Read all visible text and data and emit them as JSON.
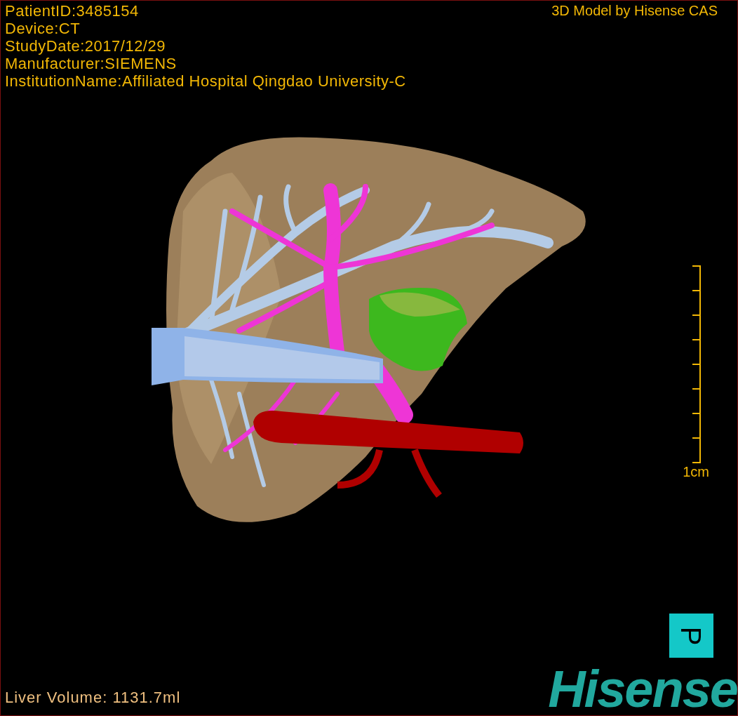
{
  "patient_info": [
    "PatientID:3485154",
    "Device:CT",
    "StudyDate:2017/12/29",
    "Manufacturer:SIEMENS",
    "InstitutionName:Affiliated Hospital Qingdao University-C"
  ],
  "model_credit": "3D Model by Hisense CAS",
  "scale_bar": {
    "label": "1cm"
  },
  "orientation_marker": "P",
  "liver_volume": "Liver Volume: 1131.7ml",
  "logo": "Hisense"
}
